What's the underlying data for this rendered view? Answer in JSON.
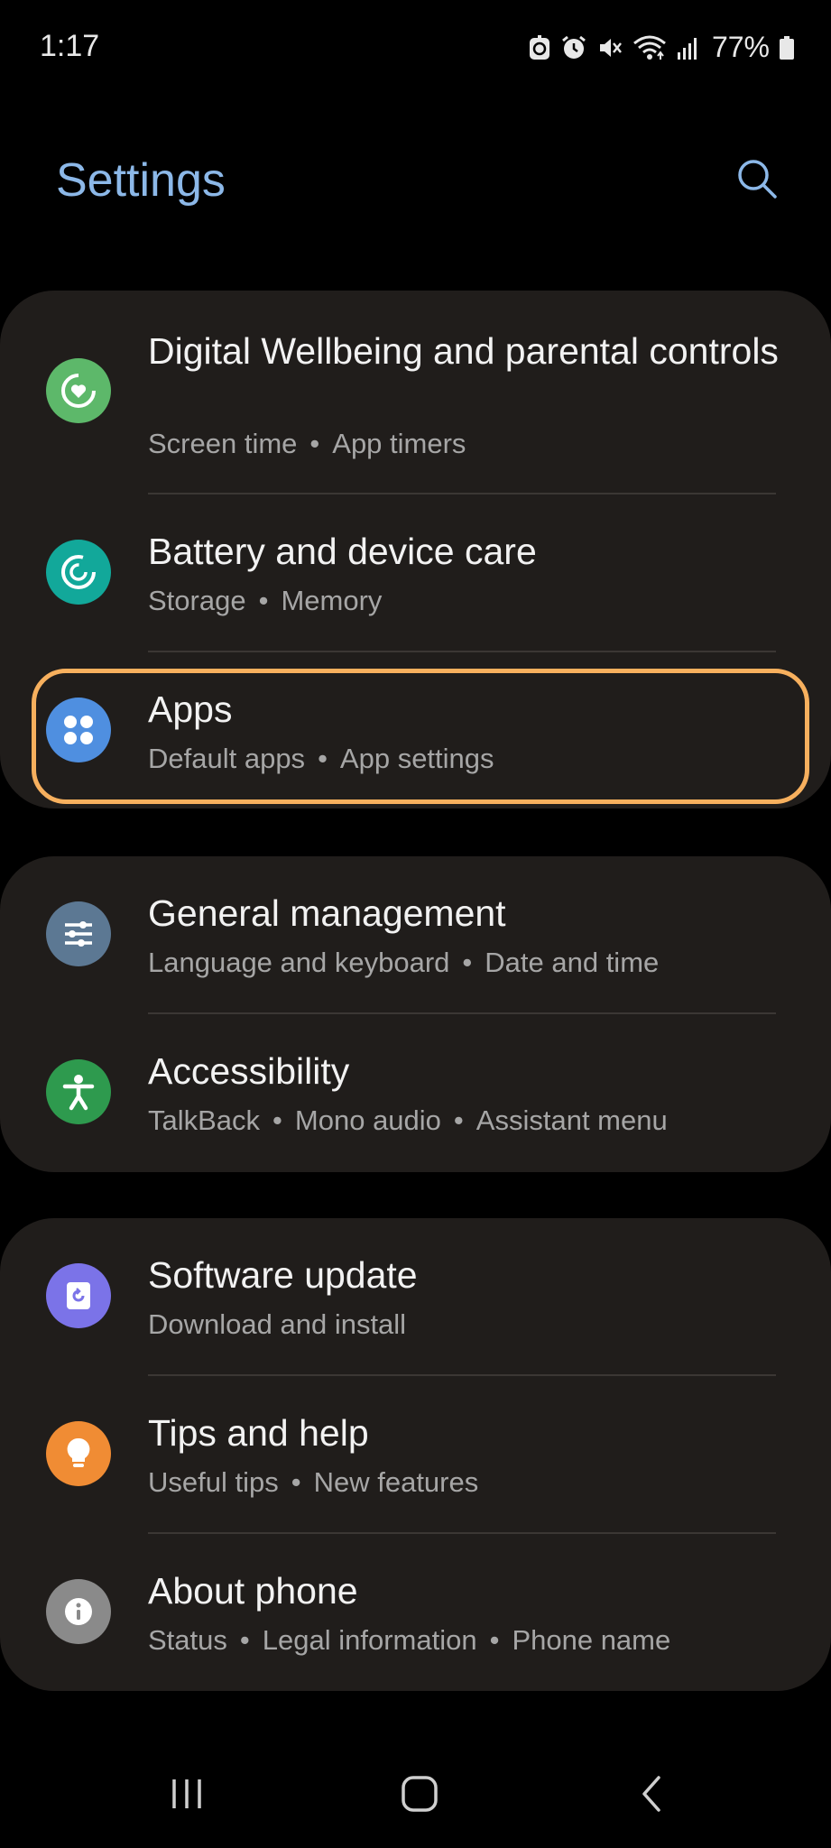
{
  "status_bar": {
    "time": "1:17",
    "battery_percent": "77%",
    "icons": [
      "data-saver-icon",
      "alarm-icon",
      "mute-icon",
      "wifi-icon",
      "signal-icon",
      "battery-icon"
    ]
  },
  "header": {
    "title": "Settings",
    "search_icon": "search-icon"
  },
  "groups": [
    {
      "items": [
        {
          "title": "Digital Wellbeing and parental controls",
          "subtitle": [
            "Screen time",
            "App timers"
          ],
          "icon": "wellbeing-icon",
          "icon_color": "#5db86a"
        },
        {
          "title": "Battery and device care",
          "subtitle": [
            "Storage",
            "Memory"
          ],
          "icon": "device-care-icon",
          "icon_color": "#12a89a"
        },
        {
          "title": "Apps",
          "subtitle": [
            "Default apps",
            "App settings"
          ],
          "icon": "apps-icon",
          "icon_color": "#4f8fe0",
          "highlighted": true
        }
      ]
    },
    {
      "items": [
        {
          "title": "General management",
          "subtitle": [
            "Language and keyboard",
            "Date and time"
          ],
          "icon": "general-management-icon",
          "icon_color": "#5c7893"
        },
        {
          "title": "Accessibility",
          "subtitle": [
            "TalkBack",
            "Mono audio",
            "Assistant menu"
          ],
          "icon": "accessibility-icon",
          "icon_color": "#2e9a4e"
        }
      ]
    },
    {
      "items": [
        {
          "title": "Software update",
          "subtitle": [
            "Download and install"
          ],
          "icon": "software-update-icon",
          "icon_color": "#7b73e8"
        },
        {
          "title": "Tips and help",
          "subtitle": [
            "Useful tips",
            "New features"
          ],
          "icon": "lightbulb-icon",
          "icon_color": "#f08c34"
        },
        {
          "title": "About phone",
          "subtitle": [
            "Status",
            "Legal information",
            "Phone name"
          ],
          "icon": "info-icon",
          "icon_color": "#8a8a8a"
        }
      ]
    }
  ],
  "nav_bar": {
    "buttons": [
      "recent-apps-icon",
      "home-icon",
      "back-icon"
    ]
  },
  "colors": {
    "title_accent": "#8cb8e8",
    "card_background": "#201d1b",
    "highlight_border": "#f7b05e"
  }
}
